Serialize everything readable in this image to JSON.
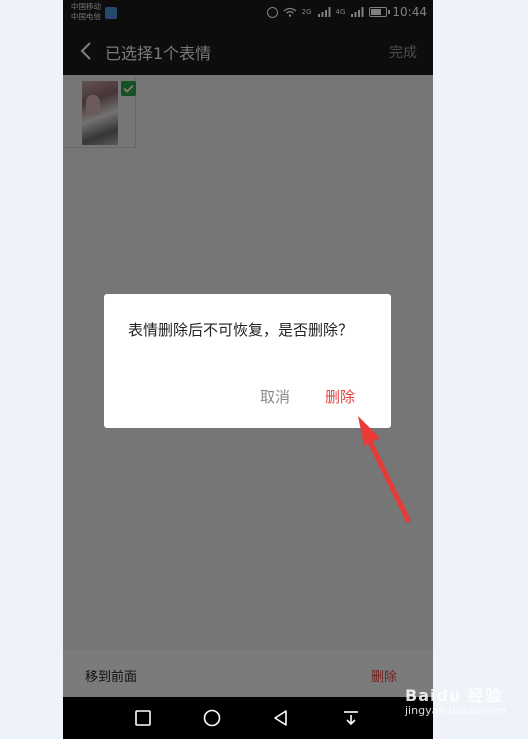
{
  "status_bar": {
    "carrier_1": "中国移动",
    "carrier_2": "中国电信",
    "network_1": "2G",
    "network_2": "4G",
    "time": "10:44",
    "battery_level": 0.7
  },
  "header": {
    "back_icon": "chevron-left-icon",
    "title": "已选择1个表情",
    "done_label": "完成"
  },
  "grid": {
    "items": [
      {
        "selected": true,
        "check_icon": "checkmark-icon"
      }
    ]
  },
  "dialog": {
    "message": "表情删除后不可恢复，是否删除？",
    "cancel_label": "取消",
    "delete_label": "删除"
  },
  "bottom_bar": {
    "move_front_label": "移到前面",
    "delete_label": "删除"
  },
  "nav_bar": {
    "buttons": [
      "square-icon",
      "circle-icon",
      "triangle-back-icon",
      "pull-down-icon"
    ]
  },
  "watermark": {
    "brand": "Baidu 经验",
    "sub": "jingyan.baidu.com"
  },
  "colors": {
    "accent_red": "#e64340",
    "check_green": "#2ba245",
    "bar_dark": "#1a1a1a"
  }
}
